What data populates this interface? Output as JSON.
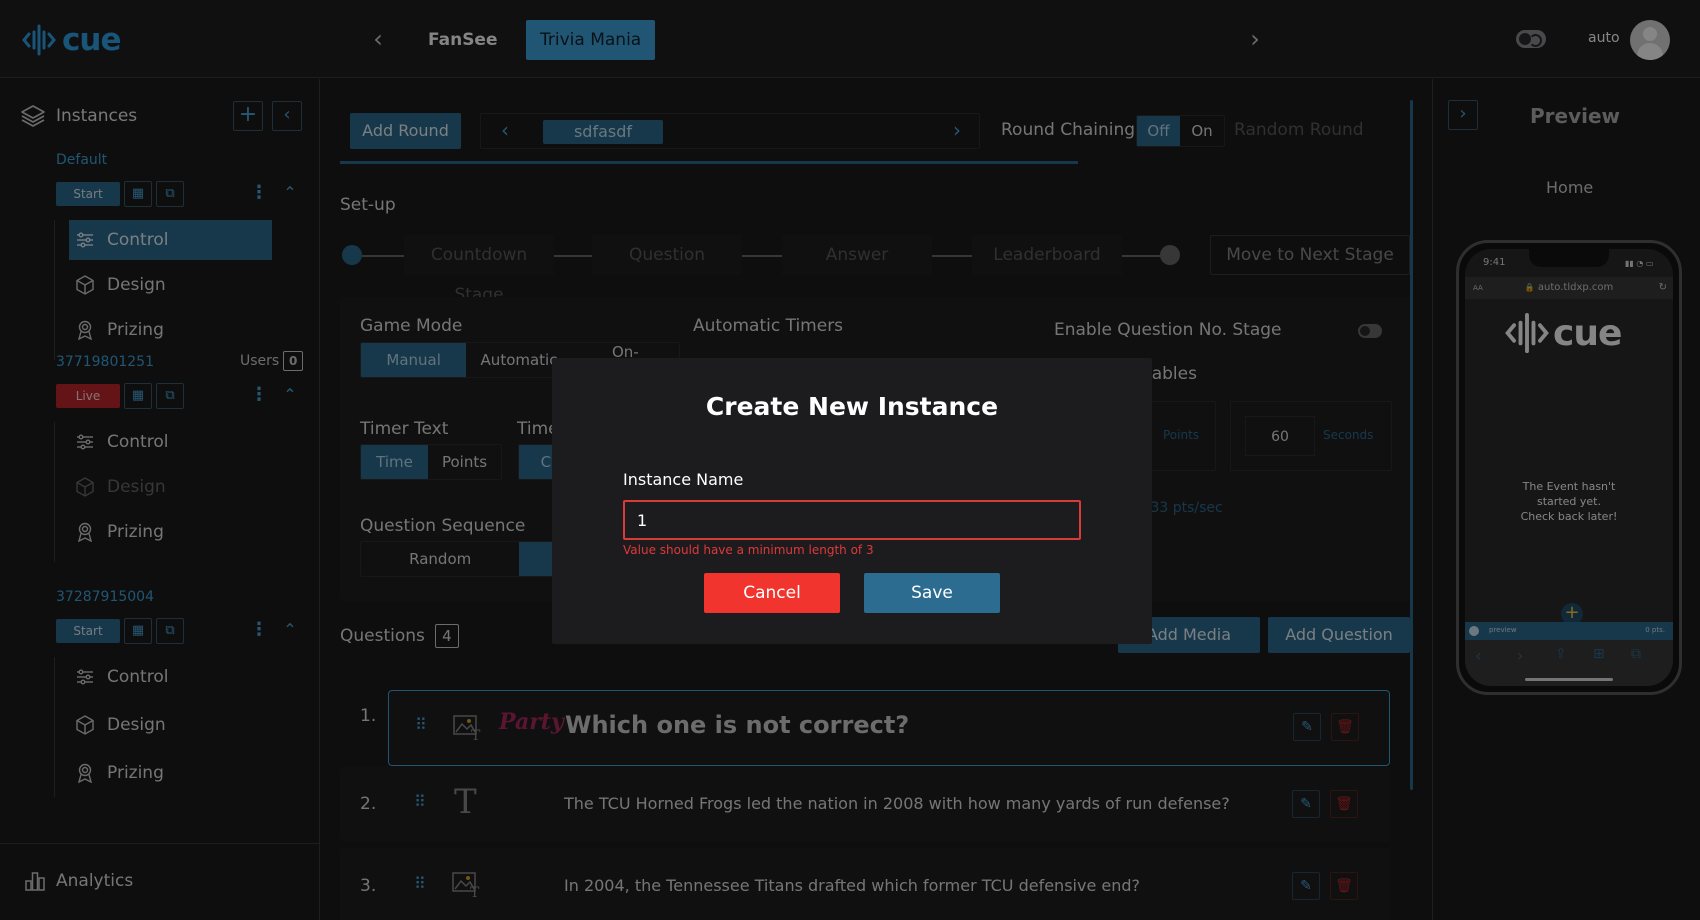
{
  "header": {
    "logo_text": "cue",
    "tabs": [
      {
        "label": "FanSee",
        "active": false
      },
      {
        "label": "Trivia Mania",
        "active": true
      }
    ],
    "theme_mode_label": "auto",
    "accent_color": "#3ea6dc"
  },
  "sidebar": {
    "title": "Instances",
    "instances": [
      {
        "name": "Default",
        "status": "Start",
        "users_label": "",
        "users_count": "",
        "items": [
          "Control",
          "Design",
          "Prizing"
        ]
      },
      {
        "name": "37719801251",
        "status": "Live",
        "users_label": "Users",
        "users_count": "0",
        "items": [
          "Control",
          "Design",
          "Prizing"
        ]
      },
      {
        "name": "37287915004",
        "status": "Start",
        "users_label": "",
        "users_count": "",
        "items": [
          "Control",
          "Design",
          "Prizing"
        ]
      }
    ],
    "analytics_label": "Analytics"
  },
  "toolbar": {
    "add_round": "Add Round",
    "current_round": "sdfasdf",
    "round_chaining_label": "Round Chaining",
    "chaining_off": "Off",
    "chaining_on": "On",
    "random_round_label": "Random Round"
  },
  "setup": {
    "title": "Set-up",
    "stages": [
      "Countdown Stage",
      "Question",
      "Answer",
      "Leaderboard"
    ],
    "move_next": "Move to Next Stage"
  },
  "settings": {
    "game_mode_label": "Game Mode",
    "game_mode_options": [
      "Manual",
      "Automatic",
      "On-"
    ],
    "automatic_timers_label": "Automatic Timers",
    "enable_qno_label": "Enable Question No. Stage",
    "variables_label": "riables",
    "timer_text_label": "Timer Text",
    "timer_text_options": [
      "Time",
      "Points"
    ],
    "timer_type_label": "Time",
    "timer_type_selected": "Ci",
    "points_unit": "Points",
    "seconds_value": "60",
    "seconds_unit": "Seconds",
    "rate_text": ".33 pts/sec",
    "question_sequence_label": "Question Sequence",
    "question_sequence_options": [
      "Random"
    ]
  },
  "questions": {
    "label": "Questions",
    "count": "4",
    "add_media": "Add Media",
    "add_question": "Add Question",
    "items": [
      {
        "num": "1.",
        "text": "Which one is not correct?",
        "badge": "Party"
      },
      {
        "num": "2.",
        "text": "The TCU Horned Frogs led the nation in 2008 with how many yards of run defense?"
      },
      {
        "num": "3.",
        "text": "In 2004, the Tennessee Titans drafted which former TCU defensive end?"
      }
    ]
  },
  "preview": {
    "title": "Preview",
    "page": "Home",
    "time": "9:41",
    "url": "auto.tldxp.com",
    "text_size_label": "AA",
    "message": "The Event hasn't started yet. Check back later!",
    "bottom_left": "preview",
    "bottom_right": "0 pts."
  },
  "modal": {
    "title": "Create New Instance",
    "field_label": "Instance Name",
    "field_value": "1",
    "error": "Value should have a minimum length of 3",
    "cancel": "Cancel",
    "save": "Save"
  }
}
